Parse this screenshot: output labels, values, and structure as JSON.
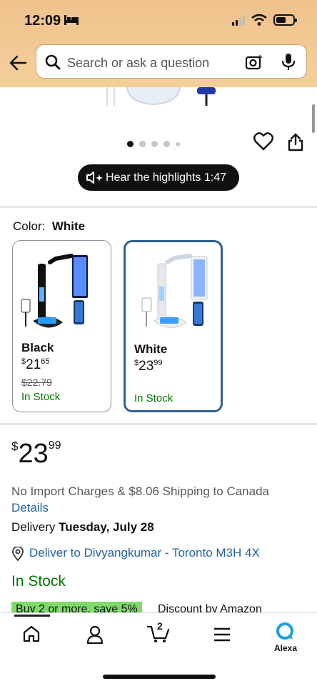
{
  "status_bar": {
    "time": "12:09"
  },
  "search": {
    "placeholder": "Search or ask a question"
  },
  "hear_highlights": {
    "label": "Hear the highlights 1:47"
  },
  "color_selector": {
    "label": "Color:",
    "selected": "White",
    "options": [
      {
        "name": "Black",
        "price_whole": "21",
        "price_cents": "65",
        "was": "$22.79",
        "stock": "In Stock"
      },
      {
        "name": "White",
        "price_whole": "23",
        "price_cents": "99",
        "stock": "In Stock"
      }
    ]
  },
  "price": {
    "currency": "$",
    "whole": "23",
    "cents": "99"
  },
  "shipping": {
    "text": "No Import Charges & $8.06 Shipping to Canada",
    "details": "Details",
    "delivery_prefix": "Delivery ",
    "delivery_date": "Tuesday, July 28",
    "deliver_to": "Deliver to Divyangkumar - Toronto M3H 4X"
  },
  "availability": "In Stock",
  "promo": {
    "badge": "Buy 2 or more, save 5%",
    "text": "Discount by Amazon"
  },
  "tabbar": {
    "cart_count": "2",
    "alexa_label": "Alexa"
  },
  "colors": {
    "header_bg": "#f0c28d",
    "link": "#2162a1",
    "in_stock": "#007600",
    "selected_border": "#2e6293",
    "promo_bg": "#7fda69"
  }
}
